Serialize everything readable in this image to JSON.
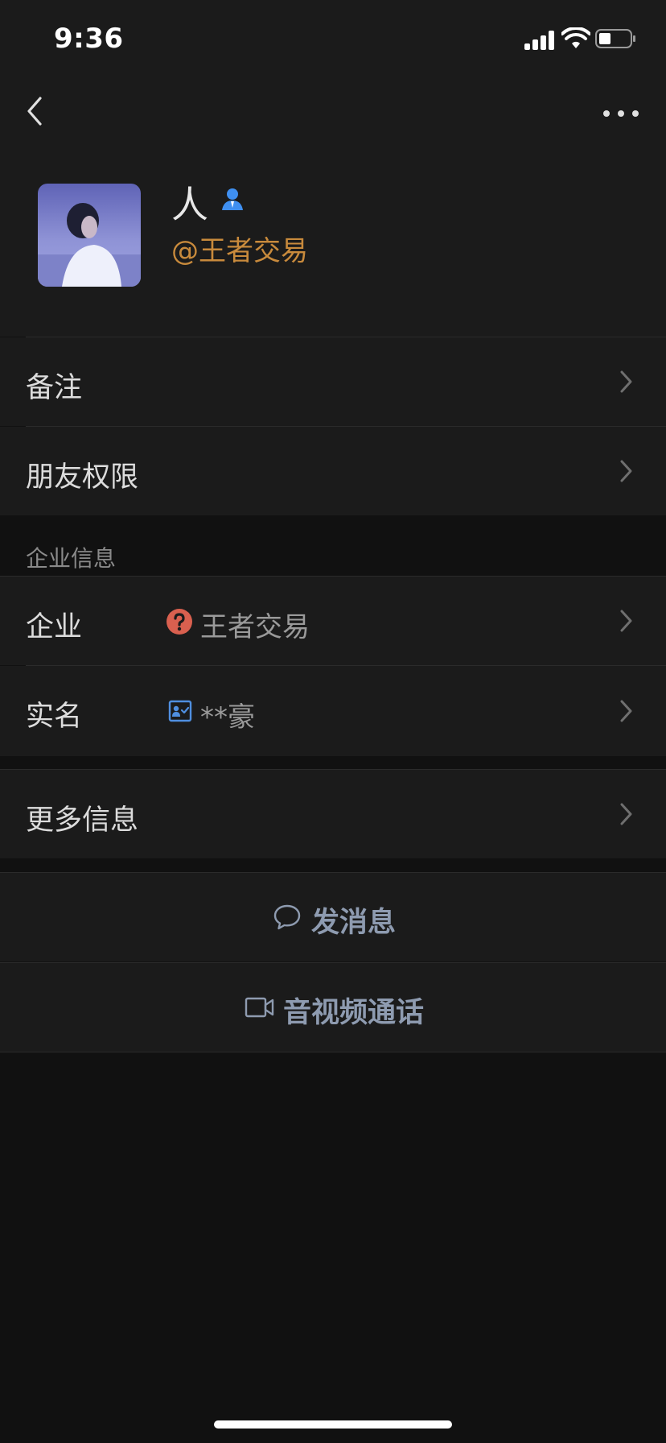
{
  "status_bar": {
    "time": "9:36"
  },
  "profile": {
    "name": "人",
    "handle": "@王者交易"
  },
  "rows": {
    "remark": "备注",
    "friend_permission": "朋友权限"
  },
  "section_title": "企业信息",
  "company": {
    "label": "企业",
    "value": "王者交易"
  },
  "realname": {
    "label": "实名",
    "value": "**豪"
  },
  "more_info": "更多信息",
  "actions": {
    "message": "发消息",
    "call": "音视频通话"
  },
  "colors": {
    "accent_handle": "#c88a3c",
    "action_text": "#8e9bb0",
    "question_badge": "#d9604f",
    "id_icon": "#4f8fe0"
  }
}
